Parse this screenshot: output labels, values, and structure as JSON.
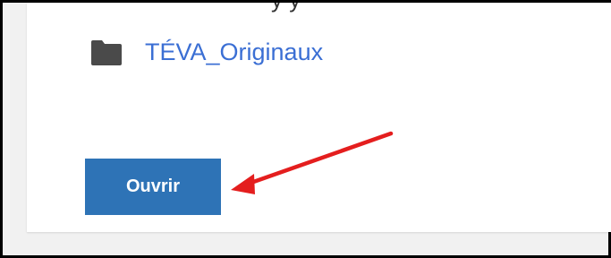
{
  "header": {
    "cut_off_text": "y          y"
  },
  "folder": {
    "icon": "folder-icon",
    "name": "TÉVA_Originaux"
  },
  "actions": {
    "open_label": "Ouvrir"
  },
  "annotation": {
    "icon": "arrow-icon",
    "color": "#e41e1e"
  },
  "colors": {
    "link": "#3b6fd4",
    "button": "#2e73b6",
    "frame": "#000000"
  }
}
